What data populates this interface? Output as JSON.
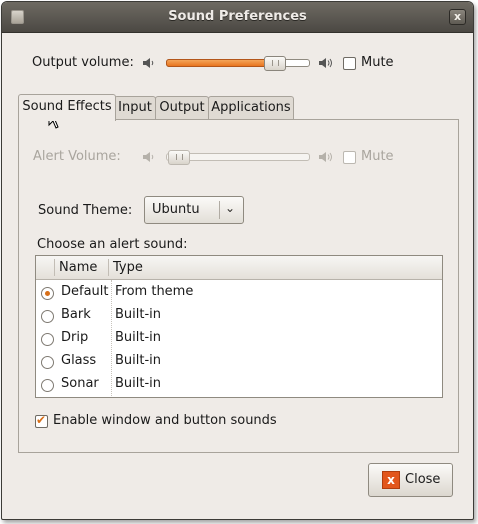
{
  "window": {
    "title": "Sound Preferences",
    "close_glyph": "x"
  },
  "output": {
    "label": "Output volume:",
    "volume_level": 0.8,
    "mute_label": "Mute",
    "mute_checked": false
  },
  "tabs": [
    {
      "label": "Sound Effects",
      "active": true
    },
    {
      "label": "Input",
      "active": false
    },
    {
      "label": "Output",
      "active": false
    },
    {
      "label": "Applications",
      "active": false
    }
  ],
  "effects": {
    "alert_label": "Alert Volume:",
    "alert_level": 0.0,
    "alert_mute_label": "Mute",
    "theme_label": "Sound Theme:",
    "theme_value": "Ubuntu",
    "choose_label": "Choose an alert sound:",
    "columns": {
      "name": "Name",
      "type": "Type"
    },
    "sounds": [
      {
        "name": "Default",
        "type": "From theme",
        "selected": true
      },
      {
        "name": "Bark",
        "type": "Built-in",
        "selected": false
      },
      {
        "name": "Drip",
        "type": "Built-in",
        "selected": false
      },
      {
        "name": "Glass",
        "type": "Built-in",
        "selected": false
      },
      {
        "name": "Sonar",
        "type": "Built-in",
        "selected": false
      }
    ],
    "enable_label": "Enable window and button sounds",
    "enable_checked": true
  },
  "buttons": {
    "close_label": "Close",
    "close_icon_glyph": "x"
  },
  "colors": {
    "accent": "#e8751f",
    "titlebar": "#4b4843",
    "window_bg": "#efebe7"
  }
}
